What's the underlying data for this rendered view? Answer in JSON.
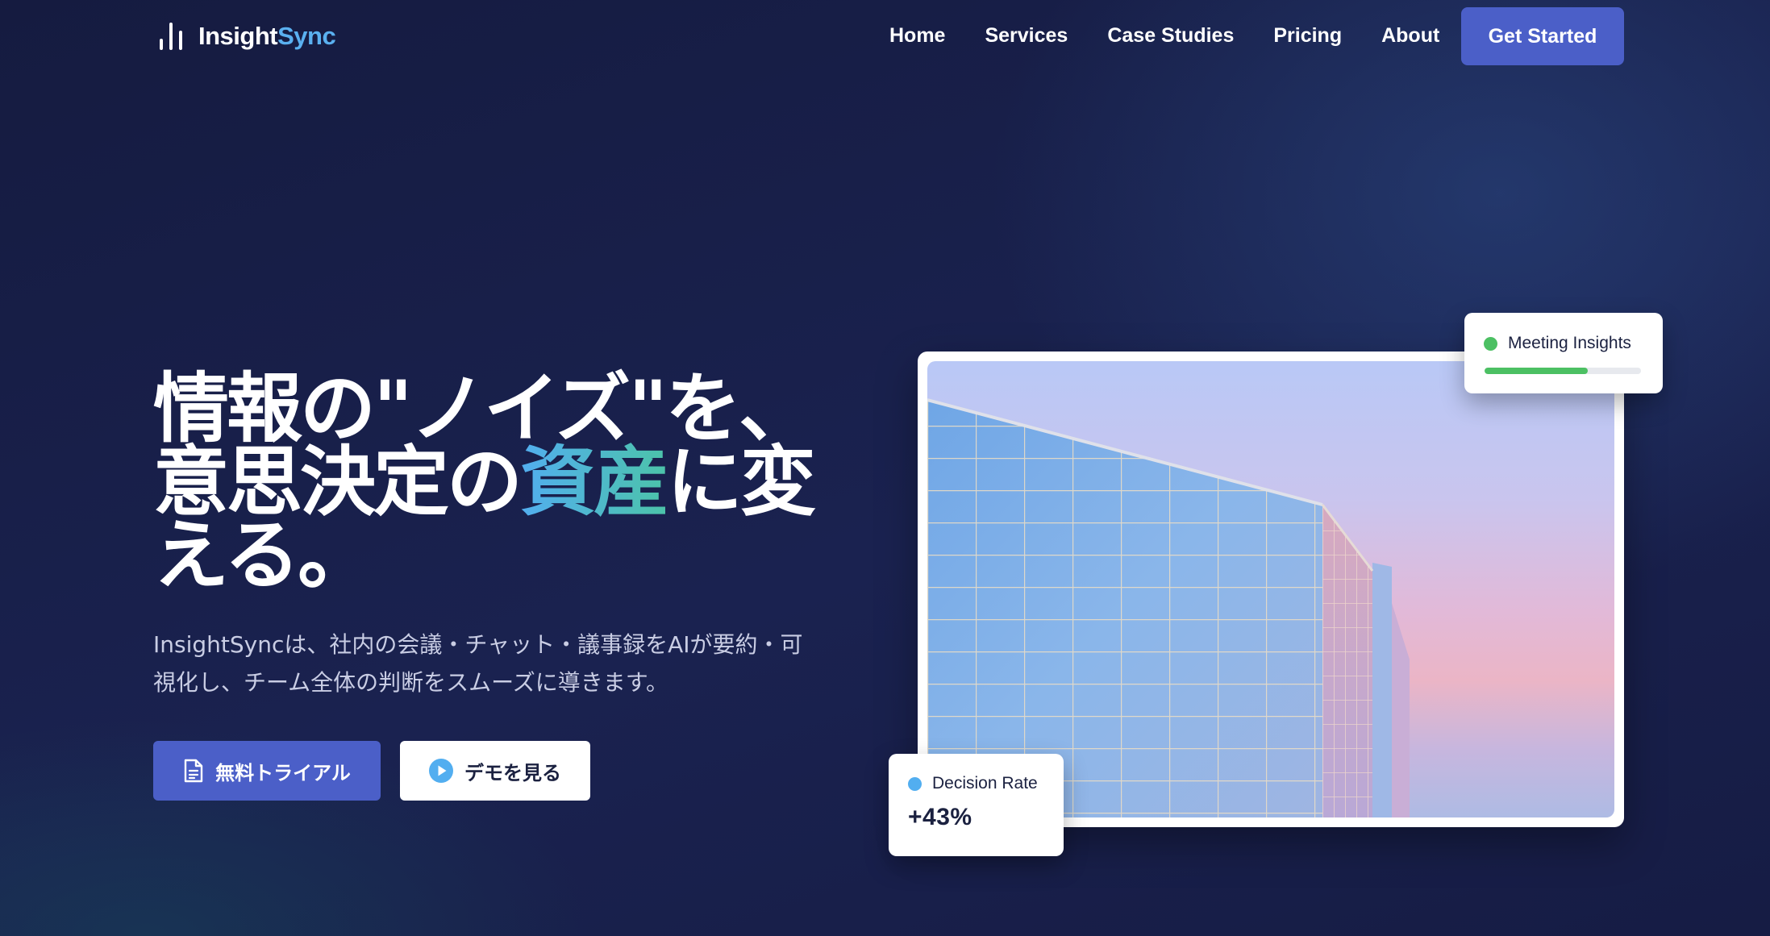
{
  "brand": {
    "name_part1": "Insight",
    "name_part2": "Sync",
    "accent_color": "#5ab0f0",
    "logo_icon": "bar-chart-icon"
  },
  "nav": {
    "links": [
      {
        "label": "Home"
      },
      {
        "label": "Services"
      },
      {
        "label": "Case Studies"
      },
      {
        "label": "Pricing"
      },
      {
        "label": "About"
      }
    ],
    "cta_label": "Get Started"
  },
  "hero": {
    "headline_line1": "情報の\"ノイズ\"を、",
    "headline_line2_pre": "意思決定の",
    "headline_highlight": "資産",
    "headline_line2_post": "に変",
    "headline_line3": "える。",
    "subtitle_line1": "InsightSyncは、社内の会議・チャット・議事録をAIが要約・可",
    "subtitle_line2": "視化し、チーム全体の判断をスムーズに導きます。",
    "primary_button": {
      "label": "無料トライアル",
      "icon": "document-icon"
    },
    "secondary_button": {
      "label": "デモを見る",
      "icon": "play-circle-icon"
    }
  },
  "cards": {
    "meeting": {
      "title": "Meeting Insights",
      "dot_color": "#4cc063",
      "progress_fraction": 0.66
    },
    "decision": {
      "title": "Decision Rate",
      "value": "+43%",
      "dot_color": "#52aef0"
    }
  },
  "colors": {
    "primary": "#4b5fc8",
    "background": "#141a3e"
  }
}
